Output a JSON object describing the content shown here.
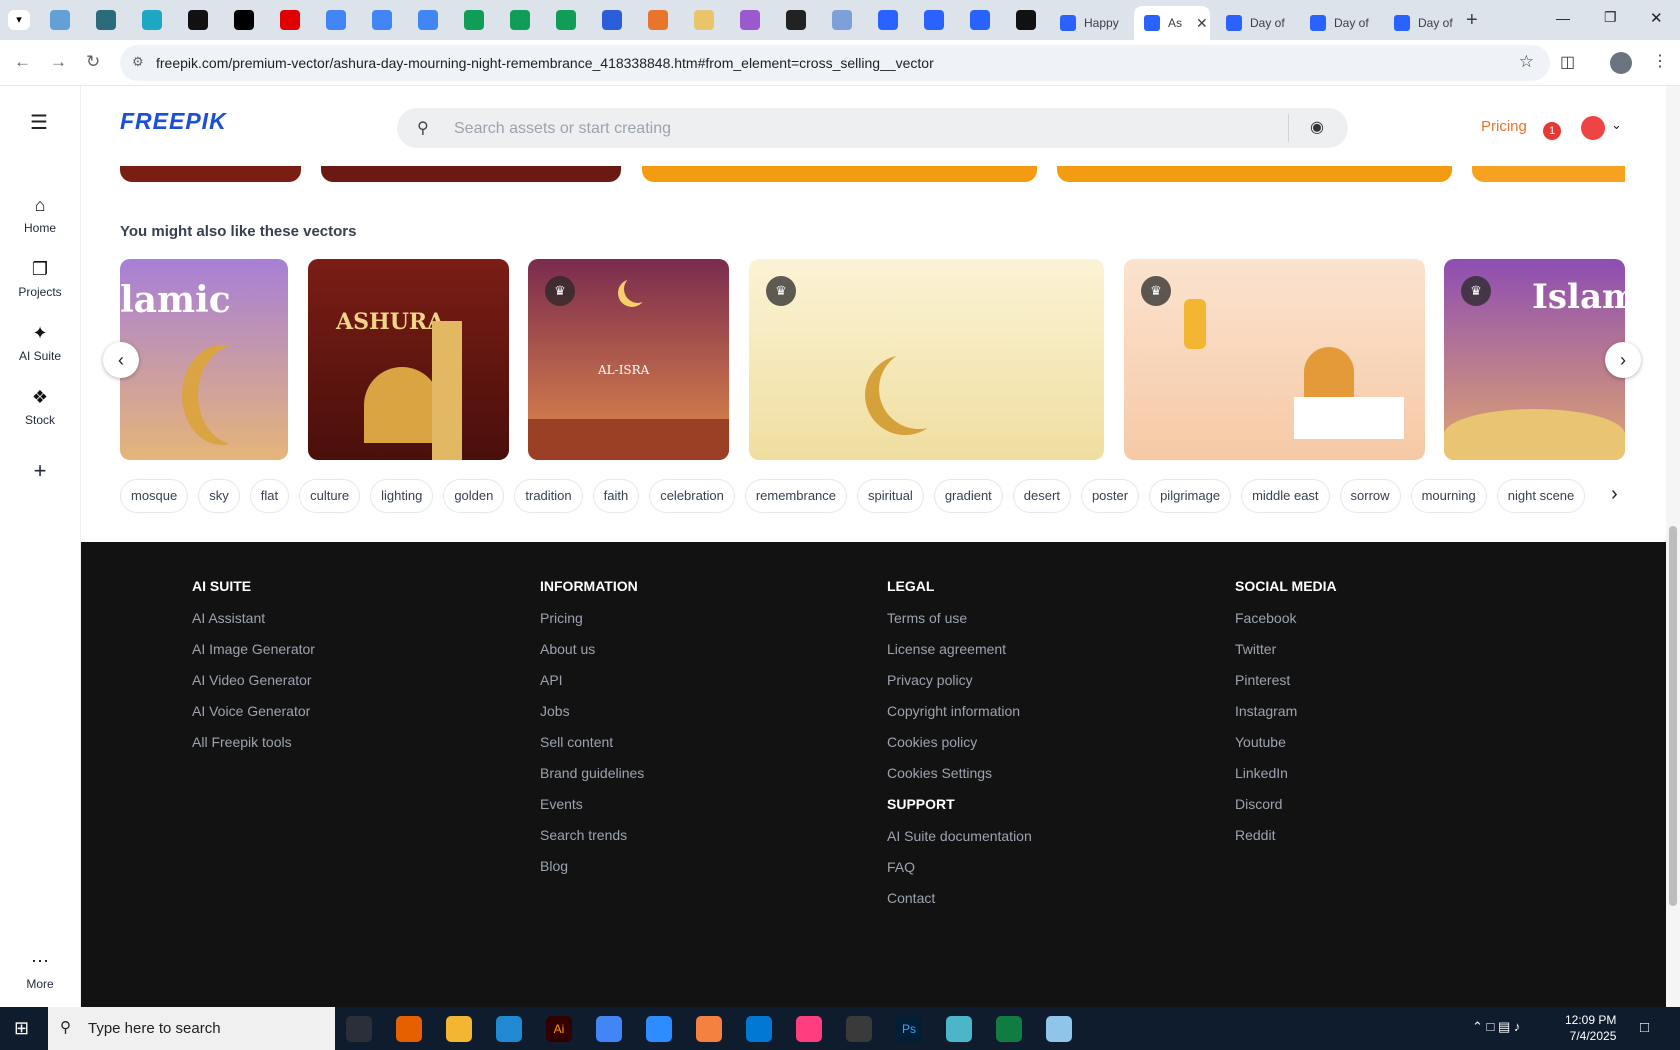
{
  "browser": {
    "tabs": [
      "Happy",
      "As",
      "Day of",
      "Day of",
      "Day of"
    ],
    "new_tab_label": "+",
    "url": "freepik.com/premium-vector/ashura-day-mourning-night-remembrance_418338848.htm#from_element=cross_selling__vector"
  },
  "header": {
    "logo": "FREEPIK",
    "search_placeholder": "Search assets or start creating",
    "pricing": "Pricing",
    "notification_count": "1"
  },
  "sidebar": {
    "items": [
      {
        "label": "Home",
        "icon": "home-icon"
      },
      {
        "label": "Projects",
        "icon": "projects-icon"
      },
      {
        "label": "AI Suite",
        "icon": "ai-suite-icon"
      },
      {
        "label": "Stock",
        "icon": "stock-icon"
      }
    ],
    "more": "More"
  },
  "section": {
    "title": "You might also like these vectors",
    "thumb_texts": [
      "lamic",
      "ASHURA",
      "AL-ISRA",
      "Islamic"
    ]
  },
  "tags": [
    "mosque",
    "sky",
    "flat",
    "culture",
    "lighting",
    "golden",
    "tradition",
    "faith",
    "celebration",
    "remembrance",
    "spiritual",
    "gradient",
    "desert",
    "poster",
    "pilgrimage",
    "middle east",
    "sorrow",
    "mourning",
    "night scene"
  ],
  "footer": {
    "ai_suite": {
      "title": "AI SUITE",
      "links": [
        "AI Assistant",
        "AI Image Generator",
        "AI Video Generator",
        "AI Voice Generator",
        "All Freepik tools"
      ]
    },
    "information": {
      "title": "INFORMATION",
      "links": [
        "Pricing",
        "About us",
        "API",
        "Jobs",
        "Sell content",
        "Brand guidelines",
        "Events",
        "Search trends",
        "Blog"
      ]
    },
    "legal": {
      "title": "LEGAL",
      "links": [
        "Terms of use",
        "License agreement",
        "Privacy policy",
        "Copyright information",
        "Cookies policy",
        "Cookies Settings"
      ]
    },
    "support": {
      "title": "SUPPORT",
      "links": [
        "AI Suite documentation",
        "FAQ",
        "Contact"
      ]
    },
    "social": {
      "title": "SOCIAL MEDIA",
      "links": [
        "Facebook",
        "Twitter",
        "Pinterest",
        "Instagram",
        "Youtube",
        "LinkedIn",
        "Discord",
        "Reddit"
      ]
    }
  },
  "taskbar": {
    "search_placeholder": "Type here to search",
    "time": "12:09 PM",
    "date": "7/4/2025"
  },
  "colors": {
    "brand": "#1d4ed8",
    "accent": "#e8752b",
    "footer_bg": "#121212"
  }
}
